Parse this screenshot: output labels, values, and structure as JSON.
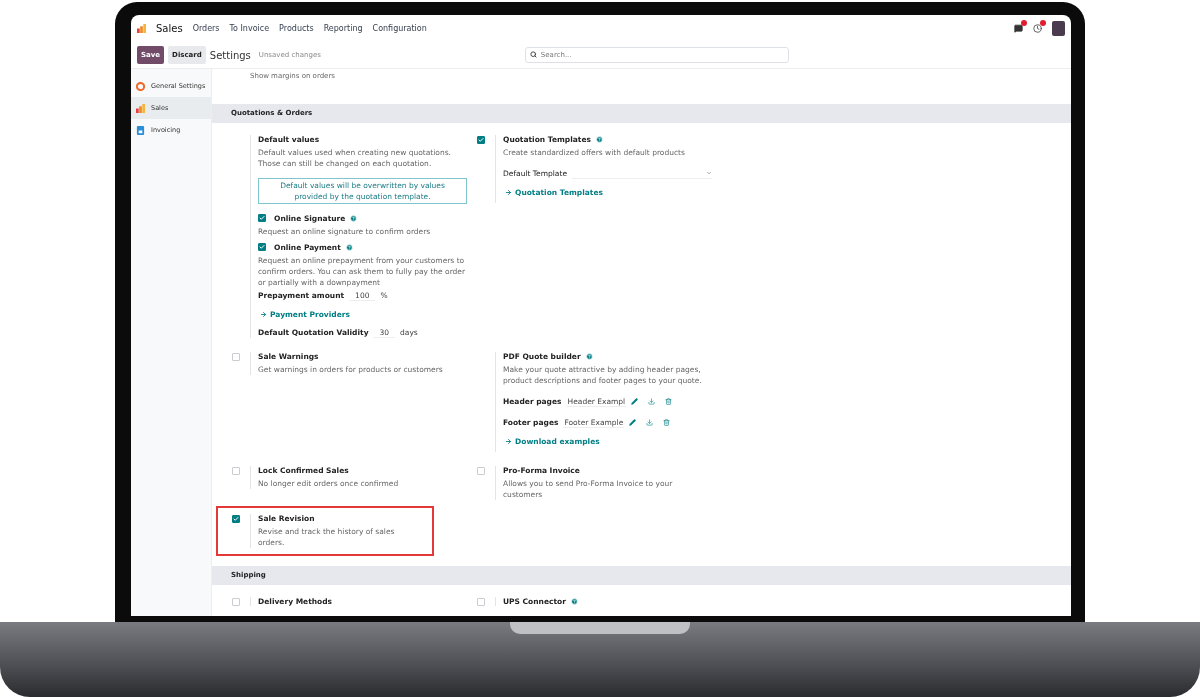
{
  "navbar": {
    "app_name": "Sales",
    "menu": [
      "Orders",
      "To Invoice",
      "Products",
      "Reporting",
      "Configuration"
    ]
  },
  "control_bar": {
    "save": "Save",
    "discard": "Discard",
    "title": "Settings",
    "status": "Unsaved changes",
    "search": {
      "placeholder": "Search..."
    }
  },
  "sidebar": {
    "items": [
      {
        "label": "General Settings",
        "selected": false
      },
      {
        "label": "Sales",
        "selected": true
      },
      {
        "label": "Invoicing",
        "selected": false
      }
    ]
  },
  "top_text": "Show margins on orders",
  "sections": [
    {
      "title": "Quotations & Orders",
      "settings": [
        {
          "kind": "plain",
          "title": "Default values",
          "description": "Default values used when creating new quotations. Those can still be changed on each quotation.",
          "extras": [
            {
              "kind": "note",
              "text": "Default values will be overwritten by values provided by the quotation template."
            },
            {
              "kind": "subsetting",
              "title": "Online Signature",
              "checked": true,
              "help": true,
              "description": "Request an online signature to confirm orders"
            },
            {
              "kind": "subsetting",
              "title": "Online Payment",
              "checked": true,
              "help": true,
              "description": "Request an online prepayment from your customers to confirm orders. You can ask them to fully pay the order or partially with a downpayment"
            },
            {
              "kind": "field",
              "label": "Prepayment amount",
              "value": "100",
              "unit": "%"
            },
            {
              "kind": "link",
              "label": "Payment Providers"
            },
            {
              "kind": "field",
              "label": "Default Quotation Validity",
              "value": "30",
              "unit": "days"
            }
          ]
        },
        {
          "kind": "checkbox",
          "title": "Quotation Templates",
          "checked": true,
          "help": true,
          "description": "Create standardized offers with default products",
          "extras": [
            {
              "kind": "select",
              "label": "Default Template"
            },
            {
              "kind": "link",
              "label": "Quotation Templates"
            }
          ]
        },
        {
          "kind": "checkbox",
          "title": "Sale Warnings",
          "checked": false,
          "description": "Get warnings in orders for products or customers"
        },
        {
          "kind": "plain",
          "title": "PDF Quote builder",
          "help": true,
          "description": "Make your quote attractive by adding header pages, product descriptions and footer pages to your quote.",
          "extras": [
            {
              "kind": "file",
              "label": "Header pages",
              "value": "Header Exampl"
            },
            {
              "kind": "file",
              "label": "Footer pages",
              "value": "Footer Example"
            },
            {
              "kind": "link",
              "label": "Download examples"
            }
          ]
        },
        {
          "kind": "checkbox",
          "title": "Lock Confirmed Sales",
          "checked": false,
          "description": "No longer edit orders once confirmed"
        },
        {
          "kind": "checkbox",
          "title": "Pro-Forma Invoice",
          "checked": false,
          "description": "Allows you to send Pro-Forma Invoice to your customers"
        },
        {
          "kind": "checkbox",
          "title": "Sale Revision",
          "checked": true,
          "highlighted": true,
          "description": "Revise and track the history of sales orders."
        }
      ]
    },
    {
      "title": "Shipping",
      "settings": [
        {
          "kind": "checkbox",
          "title": "Delivery Methods",
          "checked": false
        },
        {
          "kind": "checkbox",
          "title": "UPS Connector",
          "checked": false,
          "help": true
        }
      ]
    }
  ]
}
